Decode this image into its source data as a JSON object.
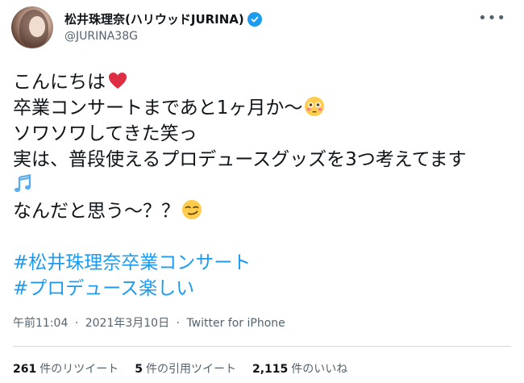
{
  "user": {
    "display_name": "松井珠理奈(ハリウッドJURINA)",
    "handle": "@JURINA38G",
    "verified": true
  },
  "icons": {
    "verified": "verified-badge-icon",
    "more": "more-options-icon",
    "heart": "red-heart-emoji",
    "flushed": "flushed-face-emoji",
    "music": "musical-notes-emoji",
    "smirk": "smirking-face-emoji"
  },
  "tweet": {
    "line1": "こんにちは",
    "line2": "卒業コンサートまであと1ヶ月か〜",
    "line3": "ソワソワしてきた笑っ",
    "line4": "実は、普段使えるプロデュースグッズを3つ考えてます",
    "line6": "なんだと思う〜？？",
    "hashtag1": "#松井珠理奈卒業コンサート",
    "hashtag2": "#プロデュース楽しい"
  },
  "meta": {
    "time": "午前11:04",
    "separator": "·",
    "date": "2021年3月10日",
    "source": "Twitter for iPhone"
  },
  "stats": {
    "retweets_count": "261",
    "retweets_label": "件のリツイート",
    "quotes_count": "5",
    "quotes_label": "件の引用ツイート",
    "likes_count": "2,115",
    "likes_label": "件のいいね"
  },
  "colors": {
    "link": "#1d9bf0",
    "text": "#0f1419",
    "secondary": "#536471",
    "divider": "#cfd9de"
  }
}
